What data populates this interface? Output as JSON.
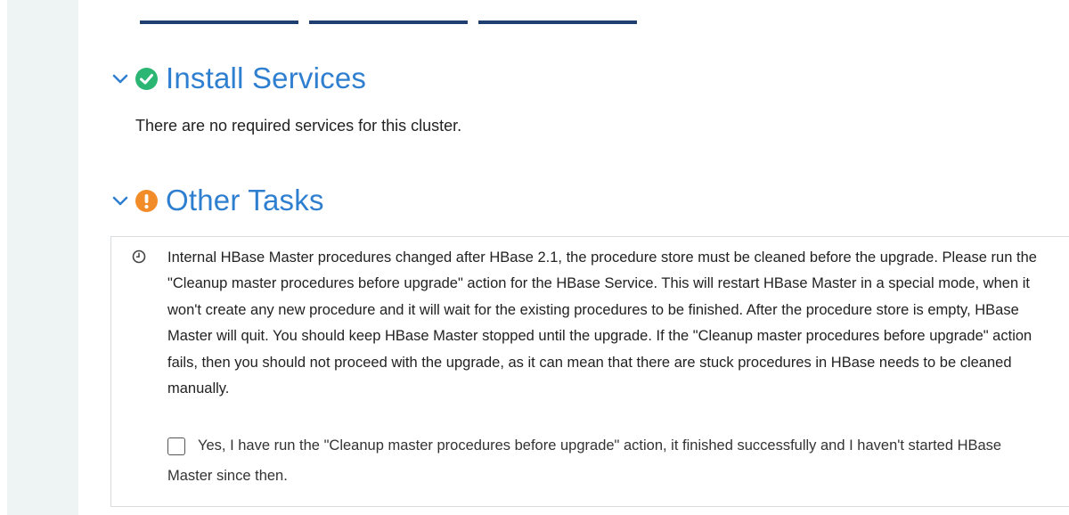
{
  "colors": {
    "accent_blue": "#2f7fd0",
    "success_green": "#2bb673",
    "warning_orange": "#f28c28",
    "top_bar_blue": "#1f3f73"
  },
  "top_bars": [
    {
      "label": ""
    },
    {
      "label": ""
    },
    {
      "label": ""
    }
  ],
  "install_services": {
    "title": "Install Services",
    "status_icon": "check-circle-icon",
    "message": "There are no required services for this cluster."
  },
  "other_tasks": {
    "title": "Other Tasks",
    "status_icon": "exclamation-circle-icon",
    "task": {
      "icon": "clock-icon",
      "description": "Internal HBase Master procedures changed after HBase 2.1, the procedure store must be cleaned before the upgrade. Please run the \"Cleanup master procedures before upgrade\" action for the HBase Service. This will restart HBase Master in a special mode, when it won't create any new procedure and it will wait for the existing procedures to be finished. After the procedure store is empty, HBase Master will quit. You should keep HBase Master stopped until the upgrade. If the \"Cleanup master procedures before upgrade\" action fails, then you should not proceed with the upgrade, as it can mean that there are stuck procedures in HBase needs to be cleaned manually.",
      "confirm_label": "Yes, I have run the \"Cleanup master procedures before upgrade\" action, it finished successfully and I haven't started HBase Master since then.",
      "confirm_checked": false
    }
  }
}
